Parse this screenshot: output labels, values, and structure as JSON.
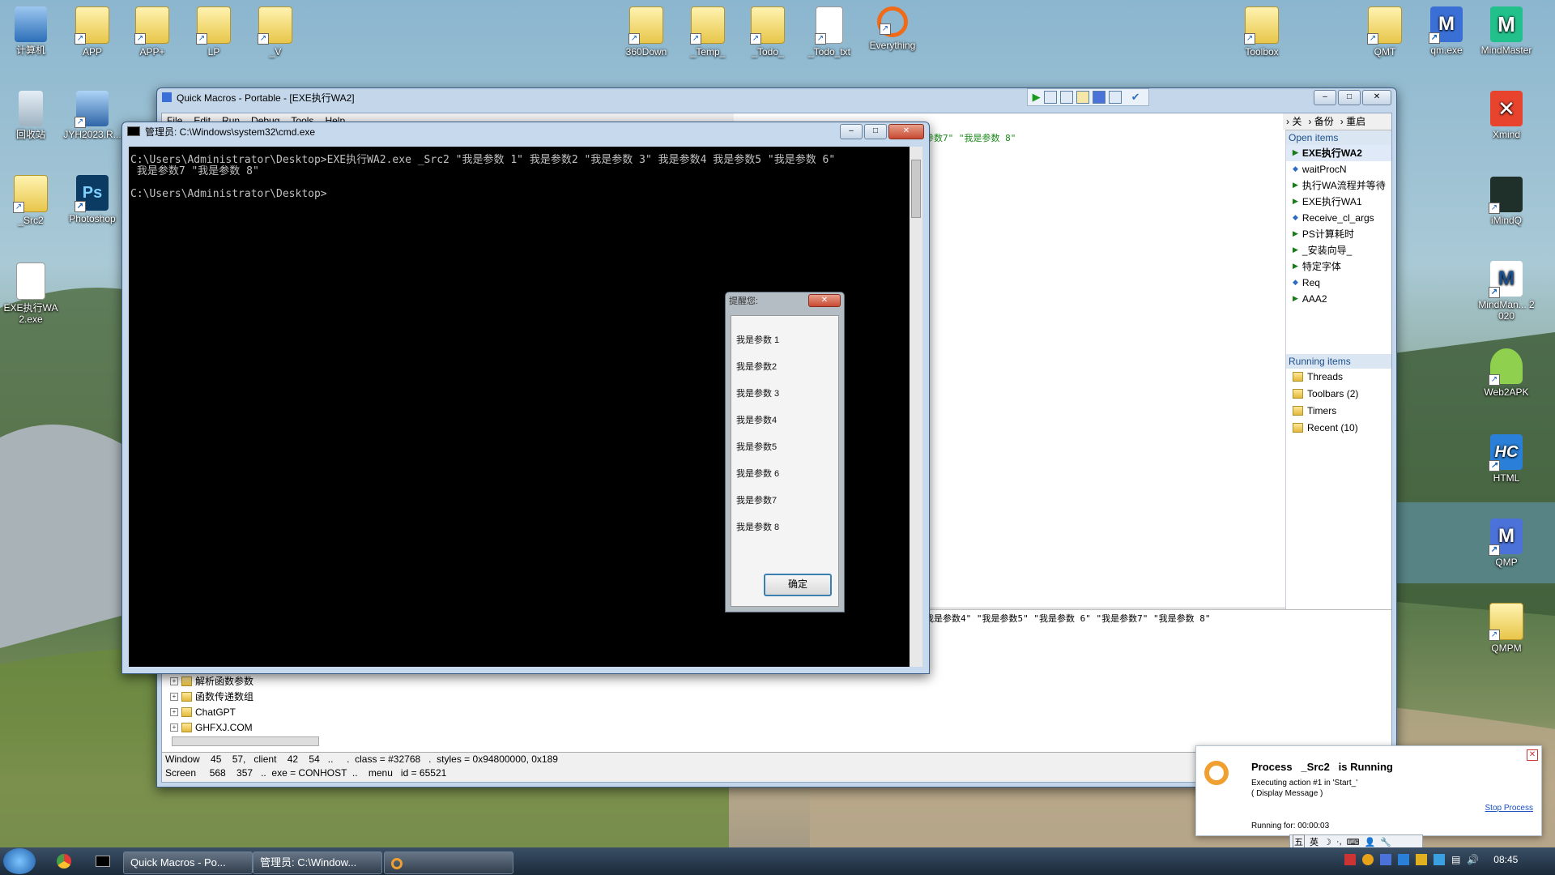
{
  "desktop": {
    "icons": [
      {
        "label": "计算机"
      },
      {
        "label": "APP"
      },
      {
        "label": "APP+"
      },
      {
        "label": "LP"
      },
      {
        "label": "_V"
      },
      {
        "label": "360Down"
      },
      {
        "label": "_Temp_"
      },
      {
        "label": "_Todo_"
      },
      {
        "label": "_Todo_txt"
      },
      {
        "label": "Everything"
      },
      {
        "label": "Toolbox"
      },
      {
        "label": "QMT"
      },
      {
        "label": "qm.exe"
      },
      {
        "label": "MindMaster"
      },
      {
        "label": "回收站"
      },
      {
        "label": "JYH2023.R..."
      },
      {
        "label": "_Src2"
      },
      {
        "label": "Photoshop"
      },
      {
        "label": "EXE执行WA2.exe"
      },
      {
        "label": "Xmind"
      },
      {
        "label": "iMindQ"
      },
      {
        "label": "MindMan... 2020"
      },
      {
        "label": "Web2APK"
      },
      {
        "label": "HTML"
      },
      {
        "label": "QMP"
      },
      {
        "label": "QMPM"
      }
    ]
  },
  "qm": {
    "title": "Quick Macros - Portable - [EXE执行WA2]",
    "menu": [
      "File",
      "Edit",
      "Run",
      "Debug",
      "Tools",
      "Help"
    ],
    "right_toolbar": [
      "关",
      "备份",
      "重启"
    ],
    "code_line1": "参数7\" \"我是参数 8\"",
    "output_line": "我是参数4\" \"我是参数5\" \"我是参数 6\" \"我是参数7\" \"我是参数 8\"",
    "open_items_header": "Open items",
    "open_items": [
      {
        "label": "EXE执行WA2",
        "kind": "macro",
        "active": true
      },
      {
        "label": "waitProcN",
        "kind": "function"
      },
      {
        "label": "执行WA流程并等待",
        "kind": "macro"
      },
      {
        "label": "EXE执行WA1",
        "kind": "macro"
      },
      {
        "label": "Receive_cl_args",
        "kind": "function"
      },
      {
        "label": "PS计算耗时",
        "kind": "macro"
      },
      {
        "label": "_安装向导_",
        "kind": "macro"
      },
      {
        "label": "特定字体",
        "kind": "macro"
      },
      {
        "label": "Req",
        "kind": "function"
      },
      {
        "label": "AAA2",
        "kind": "macro"
      }
    ],
    "running_items_header": "Running items",
    "running_items": [
      "Threads",
      "Toolbars (2)",
      "Timers",
      "Recent (10)"
    ],
    "tree": [
      "解析函数参数",
      "函数传递数组",
      "ChatGPT",
      "GHFXJ.COM"
    ],
    "status_line1": "Window    45    57,   client    42    54   ..     .  class = #32768   .  styles = 0x94800000, 0x189",
    "status_line2": "Screen     568    357   ..  exe = CONHOST  ..    menu   id = 65521"
  },
  "cmd": {
    "title": "管理员: C:\\Windows\\system32\\cmd.exe",
    "lines": [
      "C:\\Users\\Administrator\\Desktop>EXE执行WA2.exe _Src2 \"我是参数 1\" 我是参数2 \"我是参数 3\" 我是参数4 我是参数5 \"我是参数 6\"",
      " 我是参数7 \"我是参数 8\"",
      "",
      "C:\\Users\\Administrator\\Desktop>"
    ]
  },
  "msgbox": {
    "title": "提醒您:",
    "lines": [
      "我是参数 1",
      "我是参数2",
      "我是参数 3",
      "我是参数4",
      "我是参数5",
      "我是参数 6",
      "我是参数7",
      "我是参数 8"
    ],
    "ok": "确定"
  },
  "notification": {
    "title": "Process   _Src2   is Running",
    "line1": "Executing action #1 in 'Start_'",
    "line2": "( Display Message )",
    "stop": "Stop Process",
    "running_for": "Running for: 00:00:03"
  },
  "taskbar": {
    "tasks": [
      "Quick Macros - Po...",
      "管理员: C:\\Window..."
    ],
    "ime": "英",
    "ime_mode": "五",
    "clock": "08:45"
  }
}
